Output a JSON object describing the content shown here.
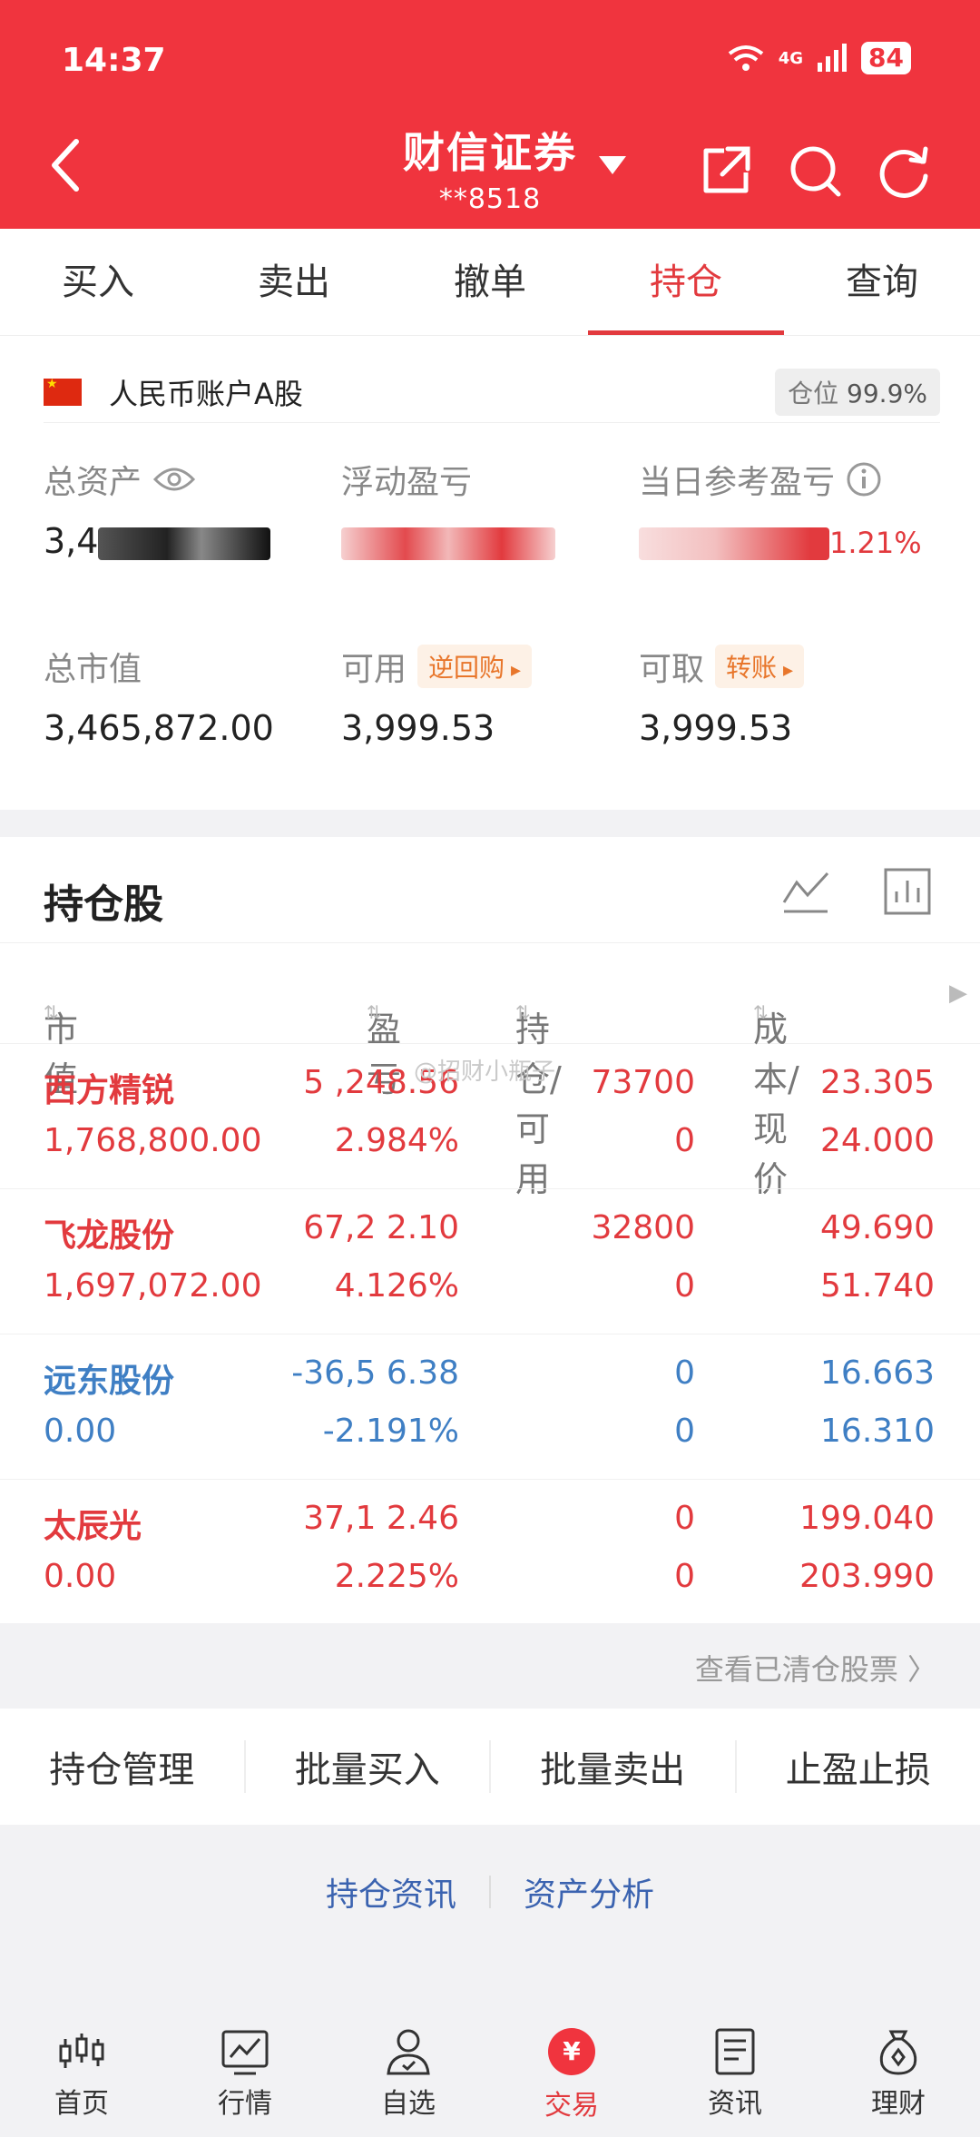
{
  "status": {
    "time": "14:37",
    "network": "4G",
    "battery": "84"
  },
  "header": {
    "title": "财信证券",
    "account": "**8518"
  },
  "tabs": [
    "买入",
    "卖出",
    "撤单",
    "持仓",
    "查询"
  ],
  "active_tab": "持仓",
  "account": {
    "name": "人民币账户A股",
    "position_label": "仓位",
    "position_value": "99.9%",
    "total_assets_label": "总资产",
    "total_assets_visible": "3,4",
    "floating_pl_label": "浮动盈亏",
    "daily_pl_label": "当日参考盈亏",
    "daily_pl_visible": "1.21%",
    "market_value_label": "总市值",
    "market_value": "3,465,872.00",
    "available_label": "可用",
    "available_tag": "逆回购",
    "available_value": "3,999.53",
    "withdrawable_label": "可取",
    "withdrawable_tag": "转账",
    "withdrawable_value": "3,999.53"
  },
  "holdings": {
    "title": "持仓股",
    "columns": [
      "市值",
      "盈亏",
      "持仓/可用",
      "成本/现价"
    ],
    "rows": [
      {
        "name": "西方精锐",
        "pl": "5 ,248.56",
        "position": "73700",
        "cost": "23.305",
        "market_value": "1,768,800.00",
        "pl_pct": "2.984%",
        "available": "0",
        "price": "24.000"
      },
      {
        "name": "飞龙股份",
        "pl": "67,2 2.10",
        "position": "32800",
        "cost": "49.690",
        "market_value": "1,697,072.00",
        "pl_pct": "4.126%",
        "available": "0",
        "price": "51.740"
      },
      {
        "name": "远东股份",
        "pl": "-36,5 6.38",
        "position": "0",
        "cost": "16.663",
        "market_value": "0.00",
        "pl_pct": "-2.191%",
        "available": "0",
        "price": "16.310"
      },
      {
        "name": "太辰光",
        "pl": "37,1 2.46",
        "position": "0",
        "cost": "199.040",
        "market_value": "0.00",
        "pl_pct": "2.225%",
        "available": "0",
        "price": "203.990"
      }
    ],
    "watermark": "@招财小瓶子",
    "cleared_link": "查看已清仓股票 〉"
  },
  "actions": [
    "持仓管理",
    "批量买入",
    "批量卖出",
    "止盈止损"
  ],
  "links": [
    "持仓资讯",
    "资产分析"
  ],
  "nav": [
    "首页",
    "行情",
    "自选",
    "交易",
    "资讯",
    "理财"
  ],
  "nav_active": "交易",
  "colors": {
    "brand": "#f0343e",
    "up": "#e23a3e",
    "down": "#3f7fc4",
    "tag": "#e8762b"
  }
}
